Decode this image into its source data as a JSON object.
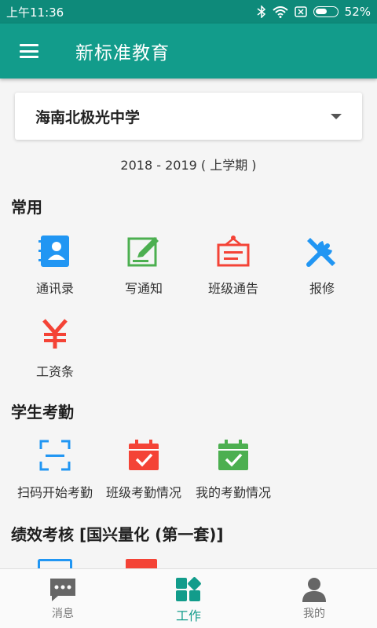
{
  "status_bar": {
    "time": "上午11:36",
    "battery": "52%"
  },
  "app_bar": {
    "title": "新标准教育"
  },
  "school_selector": {
    "value": "海南北极光中学"
  },
  "term": "2018 - 2019 ( 上学期 )",
  "sections": {
    "common": {
      "title": "常用",
      "items": [
        {
          "label": "通讯录",
          "icon": "contacts-icon",
          "color": "#2196f3"
        },
        {
          "label": "写通知",
          "icon": "edit-icon",
          "color": "#4caf50"
        },
        {
          "label": "班级通告",
          "icon": "notice-board-icon",
          "color": "#f44336"
        },
        {
          "label": "报修",
          "icon": "repair-tools-icon",
          "color": "#2196f3"
        },
        {
          "label": "工资条",
          "icon": "yen-icon",
          "color": "#f44336"
        }
      ]
    },
    "attendance": {
      "title": "学生考勤",
      "items": [
        {
          "label": "扫码开始考勤",
          "icon": "scan-icon",
          "color": "#2196f3"
        },
        {
          "label": "班级考勤情况",
          "icon": "calendar-check-icon",
          "color": "#f44336"
        },
        {
          "label": "我的考勤情况",
          "icon": "calendar-check-icon",
          "color": "#4caf50"
        }
      ]
    },
    "performance": {
      "title": "绩效考核 [国兴量化 (第一套)]"
    }
  },
  "bottom_nav": {
    "items": [
      {
        "label": "消息",
        "icon": "chat-icon"
      },
      {
        "label": "工作",
        "icon": "dashboard-icon"
      },
      {
        "label": "我的",
        "icon": "person-icon"
      }
    ],
    "active_index": 1
  },
  "colors": {
    "primary": "#129c8b",
    "status_bar": "#0e8a7a",
    "blue": "#2196f3",
    "green": "#4caf50",
    "red": "#f44336"
  }
}
